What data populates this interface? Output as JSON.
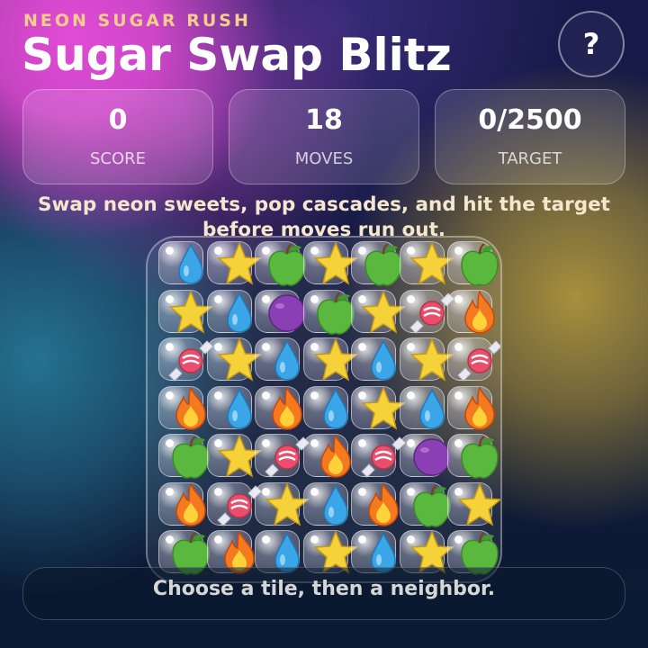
{
  "header": {
    "eyebrow": "NEON SUGAR RUSH",
    "title": "Sugar Swap Blitz",
    "help_label": "?"
  },
  "stats": {
    "score": {
      "value": "0",
      "label": "SCORE"
    },
    "moves": {
      "value": "18",
      "label": "MOVES"
    },
    "target": {
      "value": "0/2500",
      "label": "TARGET"
    }
  },
  "tagline": "Swap neon sweets, pop cascades, and hit the target before moves run out.",
  "board": {
    "rows": [
      [
        "drop",
        "star",
        "apple",
        "star",
        "apple",
        "star",
        "apple"
      ],
      [
        "star",
        "drop",
        "grape",
        "apple",
        "star",
        "candy",
        "flame"
      ],
      [
        "candy",
        "star",
        "drop",
        "star",
        "drop",
        "star",
        "candy"
      ],
      [
        "flame",
        "drop",
        "flame",
        "drop",
        "star",
        "drop",
        "flame"
      ],
      [
        "apple",
        "star",
        "candy",
        "flame",
        "candy",
        "grape",
        "apple"
      ],
      [
        "flame",
        "candy",
        "star",
        "drop",
        "flame",
        "apple",
        "star"
      ],
      [
        "apple",
        "flame",
        "drop",
        "star",
        "drop",
        "star",
        "apple"
      ]
    ]
  },
  "colors": {
    "star": "#f6d23a",
    "drop": "#3aa6e8",
    "apple": "#5ab83e",
    "grape": "#8b3fb5",
    "candy": "#e94e6d",
    "flame": "#f47a1f"
  },
  "status": "Choose a tile, then a neighbor."
}
